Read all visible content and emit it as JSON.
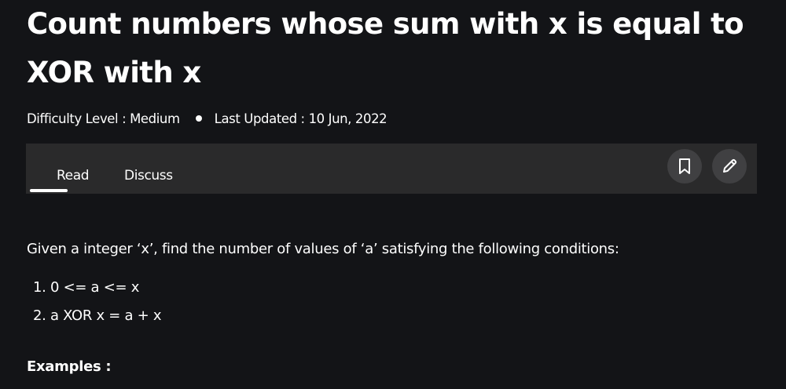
{
  "article": {
    "title": "Count numbers whose sum with x is equal to XOR with x",
    "difficulty": "Difficulty Level : Medium",
    "last_updated": "Last Updated : 10 Jun, 2022"
  },
  "tabs": {
    "read": "Read",
    "discuss": "Discuss",
    "active": "Read"
  },
  "actions": {
    "bookmark_icon": "bookmark-icon",
    "edit_icon": "pencil-icon"
  },
  "content": {
    "intro": "Given a integer ‘x’, find the number of values of ‘a’ satisfying the following conditions:",
    "conditions": [
      "1. 0 <= a <= x",
      "2. a XOR x = a + x"
    ],
    "examples_heading": "Examples :"
  },
  "colors": {
    "background": "#131417",
    "tabbar": "#2a2a2b",
    "icon_button": "#404042",
    "text": "#ffffff"
  }
}
